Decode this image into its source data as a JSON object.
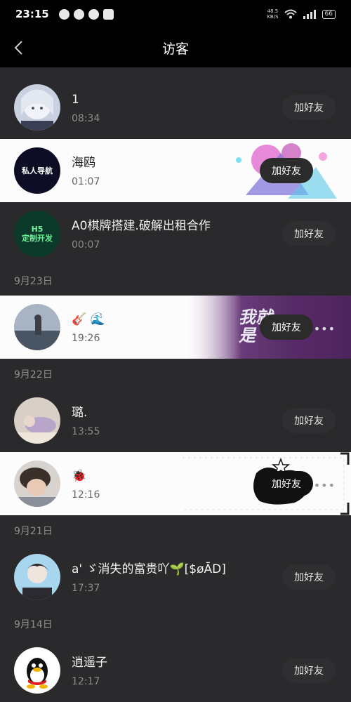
{
  "status_bar": {
    "time": "23:15",
    "speed": "48.5\nKB/S",
    "battery": "66"
  },
  "nav": {
    "title": "访客"
  },
  "add_friend_label": "加好友",
  "visitors": [
    {
      "name": "1",
      "time": "08:34"
    },
    {
      "name": "海鸥",
      "time": "01:07",
      "avatar_text": "私人导航"
    },
    {
      "name": "A0棋牌搭建.破解出租合作",
      "time": "00:07",
      "avatar_text": "H5\n定制开发"
    }
  ],
  "groups": [
    {
      "date": "9月23日",
      "visitors": [
        {
          "name": "🎸 🌊",
          "time": "19:26",
          "decor_text": "我就是"
        }
      ]
    },
    {
      "date": "9月22日",
      "visitors": [
        {
          "name": "璐.",
          "time": "13:55"
        },
        {
          "name": "🐞",
          "time": "12:16"
        }
      ]
    },
    {
      "date": "9月21日",
      "visitors": [
        {
          "name": "a' ゞ消失的富贵吖🌱[$øĀD]",
          "time": "17:37"
        }
      ]
    },
    {
      "date": "9月14日",
      "visitors": [
        {
          "name": "逍遥子",
          "time": "12:17"
        }
      ]
    }
  ],
  "colors": {
    "background": "#2a2a2c",
    "bar": "#000000",
    "light_row": "#fdfcfd"
  }
}
